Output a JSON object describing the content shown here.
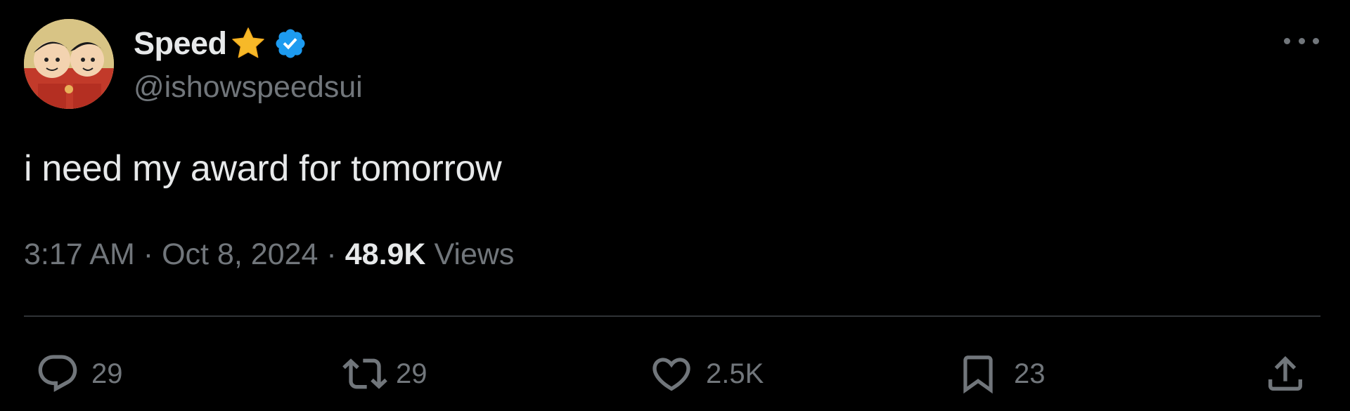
{
  "author": {
    "display_name": "Speed",
    "handle": "@ishowspeedsui",
    "avatar_icon": "profile-avatar",
    "star_icon": "star-emoji-icon",
    "verified_icon": "verified-badge-icon"
  },
  "tweet": {
    "text": "i need my award for tomorrow",
    "time": "3:17 AM",
    "separator": "·",
    "date": "Oct 8, 2024",
    "views_count": "48.9K",
    "views_label": "Views"
  },
  "actions": {
    "replies": "29",
    "reposts": "29",
    "likes": "2.5K",
    "bookmarks": "23"
  },
  "colors": {
    "background": "#000000",
    "text_primary": "#e7e9ea",
    "text_secondary": "#71767b",
    "divider": "#2f3336",
    "verified_blue": "#1d9bf0",
    "star_gold": "#f7b928"
  }
}
